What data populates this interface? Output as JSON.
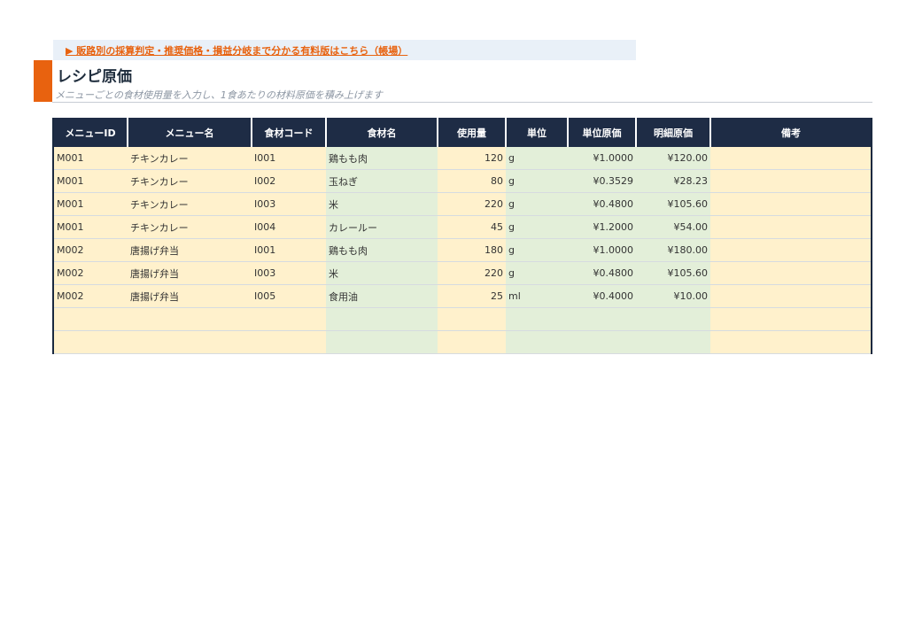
{
  "promo": {
    "link_text": "▶ 販路別の採算判定・推奨価格・損益分岐まで分かる有料版はこちら（帳場）"
  },
  "header": {
    "title": "レシピ原価",
    "subtitle": "メニューごとの食材使用量を入力し、1食あたりの材料原価を積み上げます"
  },
  "table": {
    "columns": [
      "メニューID",
      "メニュー名",
      "食材コード",
      "食材名",
      "使用量",
      "単位",
      "単位原価",
      "明細原価",
      "備考"
    ],
    "rows": [
      [
        "M001",
        "チキンカレー",
        "I001",
        "鶏もも肉",
        "120",
        "g",
        "¥1.0000",
        "¥120.00",
        ""
      ],
      [
        "M001",
        "チキンカレー",
        "I002",
        "玉ねぎ",
        "80",
        "g",
        "¥0.3529",
        "¥28.23",
        ""
      ],
      [
        "M001",
        "チキンカレー",
        "I003",
        "米",
        "220",
        "g",
        "¥0.4800",
        "¥105.60",
        ""
      ],
      [
        "M001",
        "チキンカレー",
        "I004",
        "カレールー",
        "45",
        "g",
        "¥1.2000",
        "¥54.00",
        ""
      ],
      [
        "M002",
        "唐揚げ弁当",
        "I001",
        "鶏もも肉",
        "180",
        "g",
        "¥1.0000",
        "¥180.00",
        ""
      ],
      [
        "M002",
        "唐揚げ弁当",
        "I003",
        "米",
        "220",
        "g",
        "¥0.4800",
        "¥105.60",
        ""
      ],
      [
        "M002",
        "唐揚げ弁当",
        "I005",
        "食用油",
        "25",
        "ml",
        "¥0.4000",
        "¥10.00",
        ""
      ],
      [
        "",
        "",
        "",
        "",
        "",
        "",
        "",
        "",
        ""
      ],
      [
        "",
        "",
        "",
        "",
        "",
        "",
        "",
        "",
        ""
      ]
    ]
  }
}
